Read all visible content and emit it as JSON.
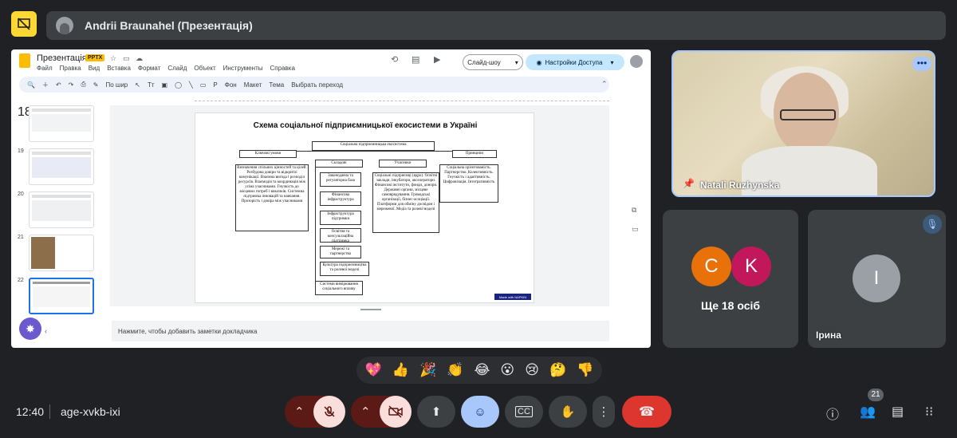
{
  "presenter": {
    "name": "Andrii Braunahel (Презентація)"
  },
  "slides_app": {
    "doc_title": "Презентація",
    "badge": "PPTX",
    "menu": [
      "Файл",
      "Правка",
      "Вид",
      "Вставка",
      "Формат",
      "Слайд",
      "Объект",
      "Инструменты",
      "Справка"
    ],
    "slideshow_label": "Слайд-шоу",
    "access_label": "Настройки Доступа",
    "toolbar": {
      "zoom": "По шир",
      "bg": "Фон",
      "layout": "Макет",
      "theme": "Тема",
      "transition": "Выбрать переход"
    },
    "thumb_numbers": [
      "18",
      "19",
      "20",
      "21",
      "22"
    ],
    "notes_placeholder": "Нажмите, чтобы добавить заметки докладчика"
  },
  "slide": {
    "title": "Схема соціальної підприємницької екосистеми в Україні",
    "center": "Соціальна підприємницька екосистема",
    "col1_head": "Ключові умови",
    "col1_body": "Визначення спільних цінностей та цілей. Розбудова довіри та відкритої комунікації. Взаємна вигода і розподіл ресурсів. Взаємодія та координація між усіма учасниками. Гнучкість до місцевих потреб і викликів. Системна підтримка інновацій та навчання. Прозорість і довіра між учасниками",
    "col2_head": "Складові",
    "col2_items": [
      "Законодавча та регуляторна база",
      "Фінансова інфраструктура",
      "Інфраструктура підтримки",
      "Освітня та консультаційна підтримка",
      "Мережі та партнерства",
      "Культура підприємництва та ролевої моделі",
      "Системи вимірювання соціального впливу"
    ],
    "col3_head": "Учасники",
    "col3_body": "Соціальні підприємці (ядро). Освітні заклади, інкубатори, акселератори. Фінансові інститути, фонди, донори. Державні органи, місцеве самоврядування. Громадські організації, бізнес-асоціації. Платформи для обміну досвідом і мережевої. Медіа та ролеві моделі",
    "col4_head": "Принципи",
    "col4_body": "Соціальна орієнтованість. Партнерство. Колективність. Гнучкість і адаптивність. Цифровізація. Інтегративність",
    "made_with": "Made with NAPKIN"
  },
  "participants": {
    "natali": "Natali Ruzhynska",
    "more_count": "Ще 18 осіб",
    "more_initials": [
      "C",
      "K"
    ],
    "irina": "Ірина",
    "irina_initial": "I"
  },
  "reactions": [
    "💖",
    "👍",
    "🎉",
    "👏",
    "😂",
    "😮",
    "😢",
    "🤔",
    "👎"
  ],
  "footer": {
    "time": "12:40",
    "meeting_code": "age-xvkb-ixi",
    "people_count": "21"
  },
  "colors": {
    "bg": "#202124",
    "accent": "#a8c7fa",
    "end_call": "#dc362e",
    "muted_bg": "#f9dedc"
  }
}
